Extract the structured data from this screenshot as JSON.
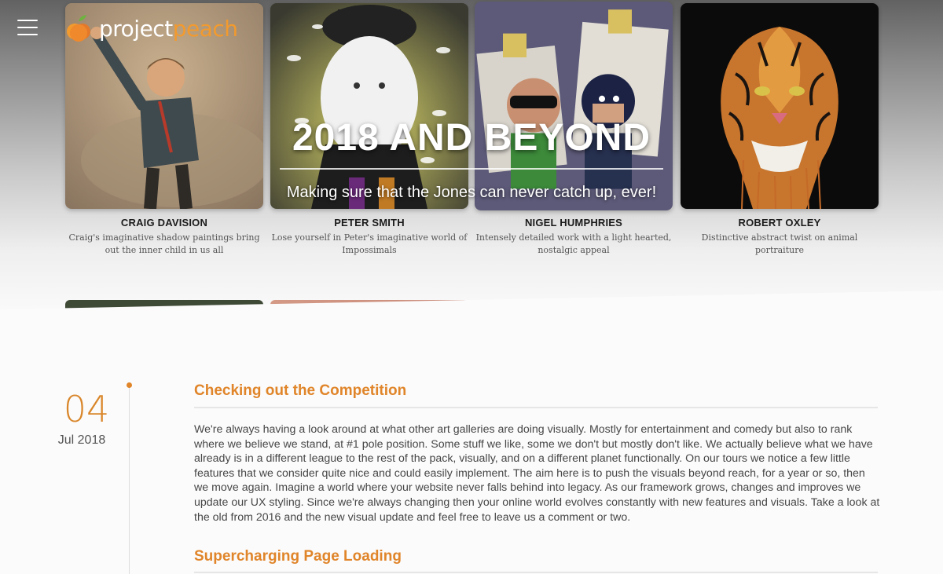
{
  "header": {
    "logo_text_main": "project",
    "logo_text_accent": "peach",
    "menu_icon": "hamburger-menu-icon",
    "accent_color": "#e0852a"
  },
  "hero": {
    "title": "2018 AND BEYOND",
    "subtitle": "Making sure that the Jones can never catch up, ever!"
  },
  "artists": [
    {
      "name": "CRAIG DAVISION",
      "description": "Craig's imaginative shadow paintings bring out the inner child in us all"
    },
    {
      "name": "PETER SMITH",
      "description": "Lose yourself in Peter's imaginative world of Impossimals"
    },
    {
      "name": "NIGEL HUMPHRIES",
      "description": "Intensely detailed work with a light hearted, nostalgic appeal"
    },
    {
      "name": "ROBERT OXLEY",
      "description": "Distinctive abstract twist on animal portraiture"
    }
  ],
  "post_date": {
    "day": "04",
    "month_year": "Jul 2018"
  },
  "posts": [
    {
      "title": "Checking out the Competition",
      "body": "We're always having a look around at what other art galleries are doing visually. Mostly for entertainment and comedy but also to rank where we believe we stand, at #1 pole position. Some stuff we like, some we don't but mostly don't like. We actually believe what we have already is in a different league to the rest of the pack, visually, and on a different planet functionally. On our tours we notice a few little features that we consider quite nice and could easily implement. The aim here is to push the visuals beyond reach, for a year or so, then we move again. Imagine a world where your website never falls behind into legacy. As our framework grows, changes and improves we update our UX styling. Since we're always changing then your online world evolves constantly with new features and visuals. Take a look at the old from 2016 and the new visual update and feel free to leave us a comment or two."
    },
    {
      "title": "Supercharging Page Loading"
    }
  ]
}
